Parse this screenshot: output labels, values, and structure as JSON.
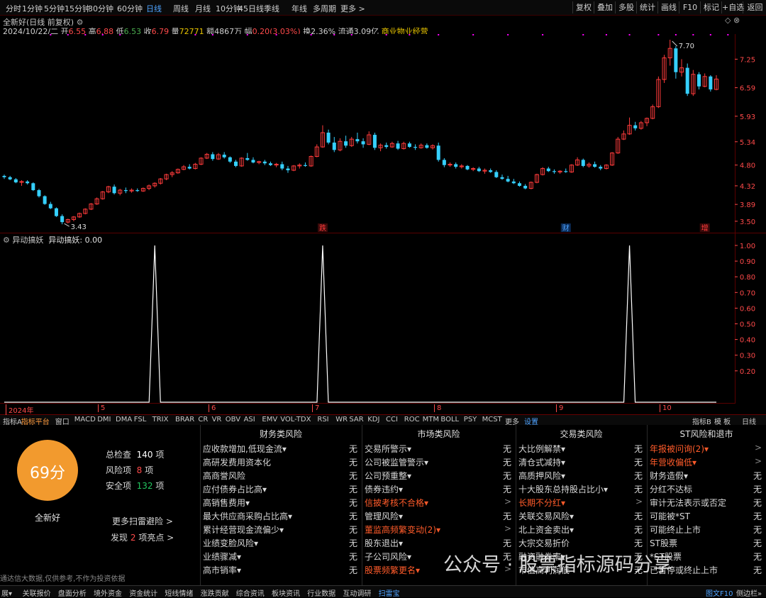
{
  "period_tabs": [
    "分时",
    "1分钟",
    "5分钟",
    "15分钟",
    "30分钟",
    "60分钟",
    "日线",
    "周线",
    "月线",
    "10分钟",
    "45日线",
    "季线",
    "年线",
    "多周期",
    "更多 >"
  ],
  "active_period": "日线",
  "right_buttons": [
    "复权",
    "叠加",
    "多股",
    "统计",
    "画线",
    "F10",
    "标记",
    "+自选",
    "返回"
  ],
  "stock": {
    "title": "全新好(日线 前复权)",
    "date": "2024/10/22/二",
    "open_label": "开",
    "open": "6.55",
    "high_label": "高",
    "high": "6.88",
    "low_label": "低",
    "low": "6.53",
    "close_label": "收",
    "close": "6.79",
    "volume_label": "量",
    "volume": "72771",
    "amount_label": "额",
    "amount": "4867万",
    "change_label": "幅",
    "change": "0.20(3.03%)",
    "turnover_label": "换",
    "turnover": "2.36%",
    "float_label": "流通",
    "float": "3.09亿",
    "industry": "商业物业经营"
  },
  "colors": {
    "up": "#ff3b3b",
    "down": "#35d0ff",
    "grid": "#5a0000",
    "axis": "#ff4a4a",
    "magenta": "#ff00ff",
    "accent": "#4ea3ff",
    "score": "#f29a2e",
    "warn": "#ff5b2a",
    "safe": "#22c55e"
  },
  "price_axis": {
    "ticks": [
      "7.25",
      "6.59",
      "5.93",
      "5.34",
      "4.80",
      "4.32",
      "3.89",
      "3.50"
    ]
  },
  "date_axis": {
    "labels": [
      "2024年",
      "5",
      "6",
      "7",
      "8",
      "9",
      "10"
    ]
  },
  "markers": {
    "high_label": "7.70",
    "low_label": "3.43",
    "event1": "跌",
    "event2": "财",
    "event3": "增"
  },
  "chart_data": {
    "type": "candlestick",
    "ylim": [
      3.4,
      7.7
    ],
    "candles": [
      [
        4.55,
        4.58,
        4.48,
        4.52
      ],
      [
        4.52,
        4.55,
        4.45,
        4.47
      ],
      [
        4.47,
        4.5,
        4.38,
        4.4
      ],
      [
        4.4,
        4.45,
        4.32,
        4.42
      ],
      [
        4.42,
        4.45,
        4.35,
        4.38
      ],
      [
        4.38,
        4.4,
        4.2,
        4.22
      ],
      [
        4.22,
        4.25,
        4.05,
        4.08
      ],
      [
        4.08,
        4.1,
        3.88,
        3.9
      ],
      [
        3.9,
        3.95,
        3.78,
        3.8
      ],
      [
        3.8,
        3.82,
        3.6,
        3.62
      ],
      [
        3.62,
        3.66,
        3.43,
        3.48
      ],
      [
        3.48,
        3.56,
        3.45,
        3.54
      ],
      [
        3.54,
        3.62,
        3.5,
        3.6
      ],
      [
        3.6,
        3.7,
        3.58,
        3.68
      ],
      [
        3.68,
        3.8,
        3.66,
        3.78
      ],
      [
        3.78,
        3.92,
        3.76,
        3.9
      ],
      [
        3.9,
        4.05,
        3.88,
        4.02
      ],
      [
        4.02,
        4.2,
        4.0,
        4.18
      ],
      [
        4.18,
        4.32,
        4.15,
        4.3
      ],
      [
        4.3,
        4.35,
        4.12,
        4.15
      ],
      [
        4.15,
        4.25,
        4.1,
        4.22
      ],
      [
        4.22,
        4.28,
        4.15,
        4.2
      ],
      [
        4.2,
        4.26,
        4.16,
        4.22
      ],
      [
        4.22,
        4.26,
        4.18,
        4.2
      ],
      [
        4.2,
        4.28,
        4.18,
        4.26
      ],
      [
        4.26,
        4.35,
        4.22,
        4.32
      ],
      [
        4.32,
        4.4,
        4.28,
        4.38
      ],
      [
        4.38,
        4.5,
        4.35,
        4.48
      ],
      [
        4.48,
        4.6,
        4.45,
        4.58
      ],
      [
        4.58,
        4.66,
        4.52,
        4.62
      ],
      [
        4.62,
        4.72,
        4.6,
        4.7
      ],
      [
        4.7,
        4.8,
        4.68,
        4.76
      ],
      [
        4.76,
        4.82,
        4.7,
        4.72
      ],
      [
        4.72,
        4.85,
        4.7,
        4.82
      ],
      [
        4.82,
        4.98,
        4.8,
        4.96
      ],
      [
        4.96,
        5.08,
        4.94,
        5.05
      ],
      [
        5.05,
        5.1,
        4.9,
        4.94
      ],
      [
        4.94,
        5.08,
        4.92,
        5.04
      ],
      [
        5.04,
        5.1,
        4.95,
        4.98
      ],
      [
        4.98,
        5.0,
        4.85,
        4.88
      ],
      [
        4.88,
        4.92,
        4.75,
        4.78
      ],
      [
        4.78,
        4.98,
        4.76,
        4.96
      ],
      [
        4.96,
        5.08,
        4.9,
        4.92
      ],
      [
        4.92,
        4.98,
        4.84,
        4.86
      ],
      [
        4.86,
        4.9,
        4.82,
        4.88
      ],
      [
        4.88,
        4.92,
        4.8,
        4.84
      ],
      [
        4.84,
        4.88,
        4.78,
        4.8
      ],
      [
        4.8,
        4.85,
        4.75,
        4.82
      ],
      [
        4.82,
        4.88,
        4.68,
        4.72
      ],
      [
        4.72,
        4.78,
        4.62,
        4.68
      ],
      [
        4.68,
        4.8,
        4.66,
        4.78
      ],
      [
        4.78,
        4.84,
        4.72,
        4.8
      ],
      [
        4.8,
        4.86,
        4.76,
        4.78
      ],
      [
        4.78,
        5.02,
        4.76,
        5.0
      ],
      [
        5.0,
        5.28,
        4.98,
        5.22
      ],
      [
        5.22,
        5.72,
        5.2,
        5.55
      ],
      [
        5.55,
        5.62,
        5.28,
        5.32
      ],
      [
        5.32,
        5.45,
        5.1,
        5.15
      ],
      [
        5.15,
        5.42,
        5.12,
        5.35
      ],
      [
        5.35,
        5.48,
        5.2,
        5.25
      ],
      [
        5.25,
        5.45,
        5.22,
        5.4
      ],
      [
        5.4,
        5.55,
        5.3,
        5.35
      ],
      [
        5.35,
        5.42,
        5.2,
        5.28
      ],
      [
        5.28,
        5.58,
        5.26,
        5.5
      ],
      [
        5.5,
        5.55,
        5.15,
        5.2
      ],
      [
        5.2,
        5.3,
        5.12,
        5.26
      ],
      [
        5.26,
        5.32,
        5.18,
        5.22
      ],
      [
        5.22,
        5.34,
        5.2,
        5.3
      ],
      [
        5.3,
        5.36,
        5.15,
        5.18
      ],
      [
        5.18,
        5.34,
        5.16,
        5.3
      ],
      [
        5.3,
        5.34,
        5.2,
        5.22
      ],
      [
        5.22,
        5.28,
        5.15,
        5.2
      ],
      [
        5.2,
        5.3,
        5.18,
        5.26
      ],
      [
        5.26,
        5.3,
        5.18,
        5.2
      ],
      [
        5.2,
        5.28,
        5.16,
        5.25
      ],
      [
        5.25,
        5.32,
        4.88,
        4.92
      ],
      [
        4.92,
        4.96,
        4.75,
        4.8
      ],
      [
        4.8,
        4.86,
        4.76,
        4.82
      ],
      [
        4.82,
        4.86,
        4.72,
        4.76
      ],
      [
        4.76,
        4.82,
        4.72,
        4.78
      ],
      [
        4.78,
        4.8,
        4.68,
        4.7
      ],
      [
        4.7,
        4.75,
        4.66,
        4.72
      ],
      [
        4.72,
        4.76,
        4.64,
        4.66
      ],
      [
        4.66,
        4.72,
        4.6,
        4.68
      ],
      [
        4.68,
        4.72,
        4.62,
        4.64
      ],
      [
        4.64,
        4.68,
        4.5,
        4.52
      ],
      [
        4.52,
        4.58,
        4.46,
        4.48
      ],
      [
        4.48,
        4.55,
        4.4,
        4.42
      ],
      [
        4.42,
        4.48,
        4.36,
        4.38
      ],
      [
        4.38,
        4.42,
        4.3,
        4.32
      ],
      [
        4.32,
        4.36,
        4.24,
        4.26
      ],
      [
        4.26,
        4.42,
        4.24,
        4.4
      ],
      [
        4.4,
        4.6,
        4.38,
        4.58
      ],
      [
        4.58,
        4.75,
        4.56,
        4.72
      ],
      [
        4.72,
        4.76,
        4.64,
        4.66
      ],
      [
        4.66,
        4.7,
        4.6,
        4.64
      ],
      [
        4.64,
        4.68,
        4.6,
        4.66
      ],
      [
        4.66,
        4.72,
        4.62,
        4.64
      ],
      [
        4.64,
        4.82,
        4.62,
        4.8
      ],
      [
        4.8,
        4.98,
        4.78,
        4.92
      ],
      [
        4.92,
        4.95,
        4.75,
        4.78
      ],
      [
        4.78,
        4.86,
        4.74,
        4.82
      ],
      [
        4.82,
        4.88,
        4.74,
        4.76
      ],
      [
        4.76,
        4.8,
        4.68,
        4.72
      ],
      [
        4.72,
        4.82,
        4.7,
        4.8
      ],
      [
        4.8,
        5.1,
        4.78,
        5.08
      ],
      [
        5.08,
        5.45,
        5.06,
        5.4
      ],
      [
        5.4,
        5.6,
        5.38,
        5.52
      ],
      [
        5.52,
        5.9,
        5.5,
        5.72
      ],
      [
        5.72,
        5.8,
        5.6,
        5.65
      ],
      [
        5.65,
        5.82,
        5.62,
        5.78
      ],
      [
        5.78,
        5.9,
        5.7,
        5.88
      ],
      [
        5.88,
        6.2,
        5.86,
        6.15
      ],
      [
        6.15,
        6.85,
        6.12,
        6.78
      ],
      [
        6.78,
        7.35,
        6.7,
        7.28
      ],
      [
        7.28,
        7.7,
        7.1,
        7.5
      ],
      [
        7.5,
        7.55,
        6.8,
        6.95
      ],
      [
        6.95,
        7.25,
        6.85,
        7.05
      ],
      [
        7.05,
        7.15,
        6.4,
        6.45
      ],
      [
        6.45,
        7.0,
        6.4,
        6.9
      ],
      [
        6.9,
        6.95,
        6.55,
        6.62
      ],
      [
        6.62,
        6.92,
        6.6,
        6.85
      ],
      [
        6.85,
        6.88,
        6.5,
        6.55
      ],
      [
        6.55,
        6.88,
        6.53,
        6.79
      ]
    ],
    "events": [
      {
        "index": 55,
        "label": "跌"
      },
      {
        "index": 97,
        "label": "财"
      },
      {
        "index": 121,
        "label": "增"
      }
    ]
  },
  "indicator": {
    "title": "异动搞妖",
    "value_text": "异动搞妖: 0.00",
    "ticks": [
      "1.00",
      "0.90",
      "0.80",
      "0.70",
      "0.60",
      "0.50",
      "0.40",
      "0.30",
      "0.20"
    ],
    "spike_indices": [
      26,
      55,
      108
    ]
  },
  "index_tabs": [
    "指标A",
    "指标平台",
    "窗口",
    "MACD",
    "DMI",
    "DMA",
    "FSL",
    "TRIX",
    "BRAR",
    "CR",
    "VR",
    "OBV",
    "ASI",
    "EMV",
    "VOL-TDX",
    "RSI",
    "WR",
    "SAR",
    "KDJ",
    "CCI",
    "ROC",
    "MTM",
    "BOLL",
    "PSY",
    "MCST",
    "更多",
    "设置"
  ],
  "index_right": [
    "指标B",
    "模 板",
    "日线"
  ],
  "score": {
    "value": "69分",
    "name": "全新好",
    "total_label": "总检查",
    "total": "140",
    "unit": "项",
    "risk_label": "风险项",
    "risk": "8",
    "safe_label": "安全项",
    "safe": "132",
    "more": "更多扫雷避险 >",
    "highlight_pre": "发现",
    "highlight": "2",
    "highlight_post": "项亮点 >"
  },
  "risk_sections": [
    {
      "title": "财务类风险",
      "rows": [
        [
          "应收款增加,低现金流▾",
          "无"
        ],
        [
          "高研发费用资本化",
          "无"
        ],
        [
          "高商誉风险",
          "无"
        ],
        [
          "应付债券占比高▾",
          "无"
        ],
        [
          "高销售费用▾",
          "无"
        ],
        [
          "最大供应商采购占比高▾",
          "无"
        ],
        [
          "累计经营现金流偏少▾",
          "无"
        ],
        [
          "业绩变脸风险▾",
          "无"
        ],
        [
          "业绩骤减▾",
          "无"
        ],
        [
          "高市销率▾",
          "无"
        ]
      ]
    },
    {
      "title": "市场类风险",
      "rows": [
        [
          "交易所警示▾",
          "无"
        ],
        [
          "公司被监管警示▾",
          "无"
        ],
        [
          "公司预重整▾",
          "无"
        ],
        [
          "债券违约▾",
          "无"
        ],
        [
          "信披考核不合格▾",
          ">"
        ],
        [
          "管理风险▾",
          "无"
        ],
        [
          "董监高频繁变动(2)▾",
          ">"
        ],
        [
          "股东退出▾",
          "无"
        ],
        [
          "子公司风险▾",
          "无"
        ],
        [
          "股票频繁更名▾",
          ">"
        ]
      ]
    },
    {
      "title": "交易类风险",
      "rows": [
        [
          "大比例解禁▾",
          "无"
        ],
        [
          "清仓式减持▾",
          "无"
        ],
        [
          "高质押风险▾",
          "无"
        ],
        [
          "十大股东总持股占比小▾",
          "无"
        ],
        [
          "长期不分红▾",
          ">"
        ],
        [
          "关联交易风险▾",
          "无"
        ],
        [
          "北上资金卖出▾",
          "无"
        ],
        [
          "大宗交易折价",
          "无"
        ],
        [
          "融资融券率▾",
          "无"
        ],
        [
          "市值高利润低",
          "无"
        ]
      ]
    },
    {
      "title": "ST风险和退市",
      "rows": [
        [
          "年报被问询(2)▾",
          ">"
        ],
        [
          "年营收偏低▾",
          ">"
        ],
        [
          "财务造假▾",
          "无"
        ],
        [
          "分红不达标",
          "无"
        ],
        [
          "审计无法表示或否定",
          "无"
        ],
        [
          "可能被*ST",
          "无"
        ],
        [
          "可能终止上市",
          "无"
        ],
        [
          "ST股票",
          "无"
        ],
        [
          "*ST股票",
          "无"
        ],
        [
          "已暂停或终止上市",
          "无"
        ]
      ]
    }
  ],
  "warn_rows": [
    "信披考核不合格▾",
    "董监高频繁变动(2)▾",
    "股票频繁更名▾",
    "长期不分红▾",
    "年报被问询(2)▾",
    "年营收偏低▾"
  ],
  "disclaimer": "通达信大数据,仅供参考,不作为投资依据",
  "watermark": "公众号 · 股票指标源码分享",
  "bottom_tabs": [
    "展▾",
    "关联报价",
    "盘面分析",
    "境外资金",
    "资金统计",
    "短线情绪",
    "涨跌贡献",
    "综合资讯",
    "板块资讯",
    "行业数据",
    "互动调研",
    "扫雷宝"
  ],
  "bottom_right": [
    "图文F10",
    "侧边栏»"
  ]
}
